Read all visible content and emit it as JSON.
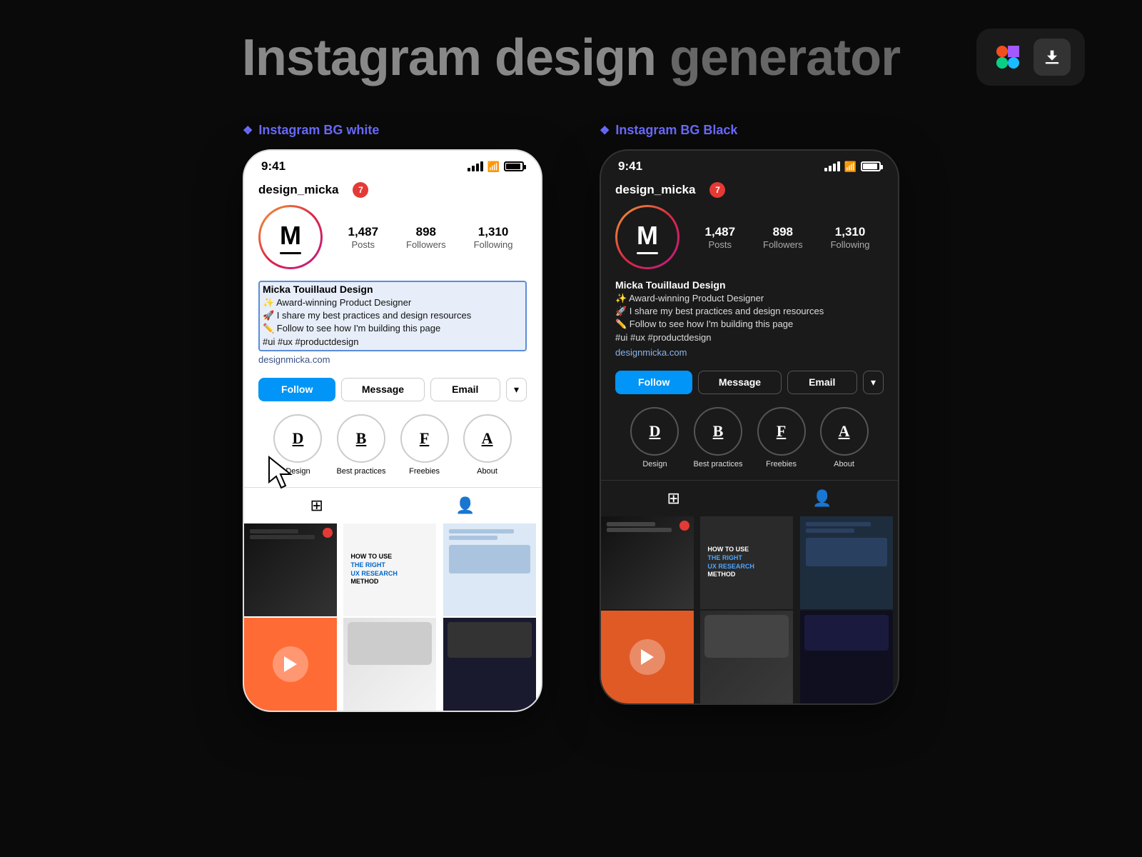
{
  "header": {
    "title_part1": "Instagram design ",
    "title_part2": "generator"
  },
  "sections": {
    "white_label": "Instagram BG white",
    "black_label": "Instagram BG Black"
  },
  "profile": {
    "username": "design_micka",
    "notification_count": "7",
    "stats": {
      "posts_count": "1,487",
      "posts_label": "Posts",
      "followers_count": "898",
      "followers_label": "Followers",
      "following_count": "1,310",
      "following_label": "Following"
    },
    "avatar_letter": "M",
    "bio_name": "Micka Touillaud Design",
    "bio_lines": [
      "✨ Award-winning Product Designer",
      "🚀 I share my best practices and design resources",
      "✏️ Follow to see how I'm building this page",
      "#ui #ux #productdesign"
    ],
    "website": "designmicka.com",
    "time": "9:41"
  },
  "buttons": {
    "follow": "Follow",
    "message": "Message",
    "email": "Email",
    "dropdown": "▾"
  },
  "highlights": [
    {
      "letter": "D",
      "label": "Design"
    },
    {
      "letter": "B",
      "label": "Best practices"
    },
    {
      "letter": "F",
      "label": "Freebies"
    },
    {
      "letter": "A",
      "label": "About"
    }
  ],
  "posts": {
    "ux_title": "HOW TO USE",
    "ux_subtitle_line1": "THE RIGHT",
    "ux_subtitle_line2": "UX RESEARCH",
    "ux_subtitle_line3": "METHOD"
  }
}
